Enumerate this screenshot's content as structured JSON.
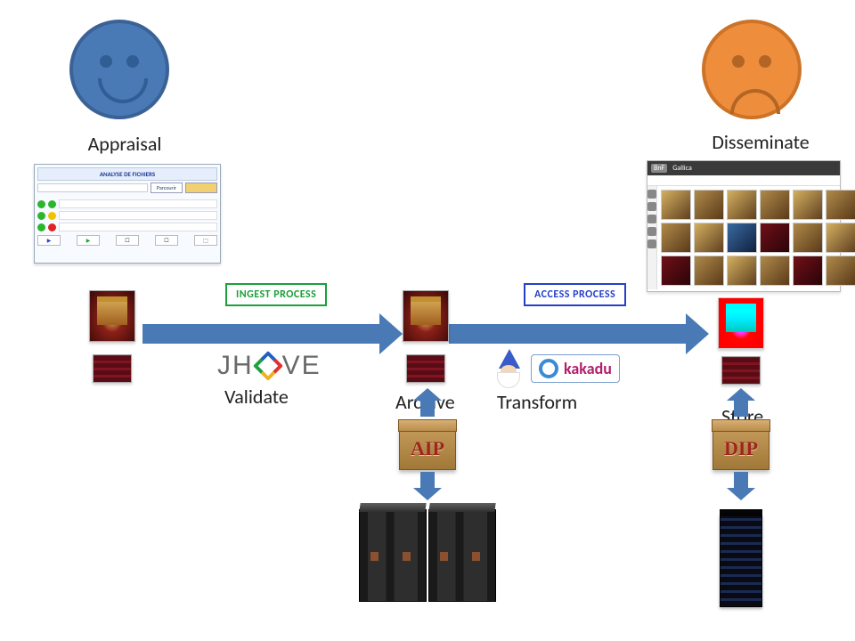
{
  "faces": {
    "happy_color": "#4a7ab6",
    "happy_eye": "#2f5d94",
    "sad_color": "#ee8e3c",
    "sad_eye": "#b26524"
  },
  "labels": {
    "appraisal": "Appraisal",
    "disseminate": "Disseminate",
    "validate": "Validate",
    "archive": "Archive",
    "transform": "Transform",
    "store": "Store"
  },
  "process": {
    "ingest": "INGEST PROCESS",
    "access": "ACCESS PROCESS",
    "ingest_color": "#1aa038",
    "access_color": "#2840c8"
  },
  "jhove": {
    "pre": "JH",
    "post": "VE"
  },
  "kakadu": {
    "label": "kakadu"
  },
  "packages": {
    "aip": "AIP",
    "dip": "DIP"
  },
  "app": {
    "title": "ANALYSE DE FICHIERS",
    "btn_browse": "Parcourir"
  },
  "gallery": {
    "brand1": "BnF",
    "brand2": "Gallica"
  }
}
